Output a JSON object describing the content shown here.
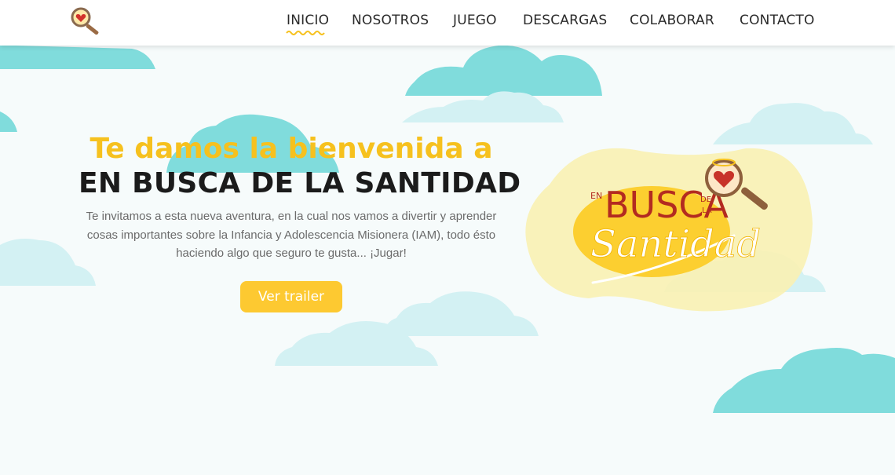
{
  "nav": {
    "items": [
      "INICIO",
      "NOSOTROS",
      "JUEGO",
      "DESCARGAS",
      "COLABORAR",
      "CONTACTO"
    ],
    "active": "INICIO"
  },
  "hero": {
    "welcome": "Te damos la bienvenida a",
    "title": "EN BUSCA DE LA SANTIDAD",
    "description": "Te invitamos a esta nueva aventura, en la cual nos vamos a divertir y aprender cosas importantes sobre la Infancia y Adolescencia Misionera (IAM), todo ésto haciendo algo que seguro te gusta... ¡Jugar!",
    "cta_label": "Ver trailer"
  },
  "game_logo": {
    "en": "EN",
    "busca": "BUSCA",
    "de": "DE",
    "la": "LA",
    "santidad": "Santidad"
  },
  "colors": {
    "accent_yellow": "#f6c11e",
    "button_yellow": "#fdc931",
    "cloud_teal": "#80dcdc",
    "cloud_light": "#d3f1f3",
    "logo_red": "#b32b20"
  }
}
